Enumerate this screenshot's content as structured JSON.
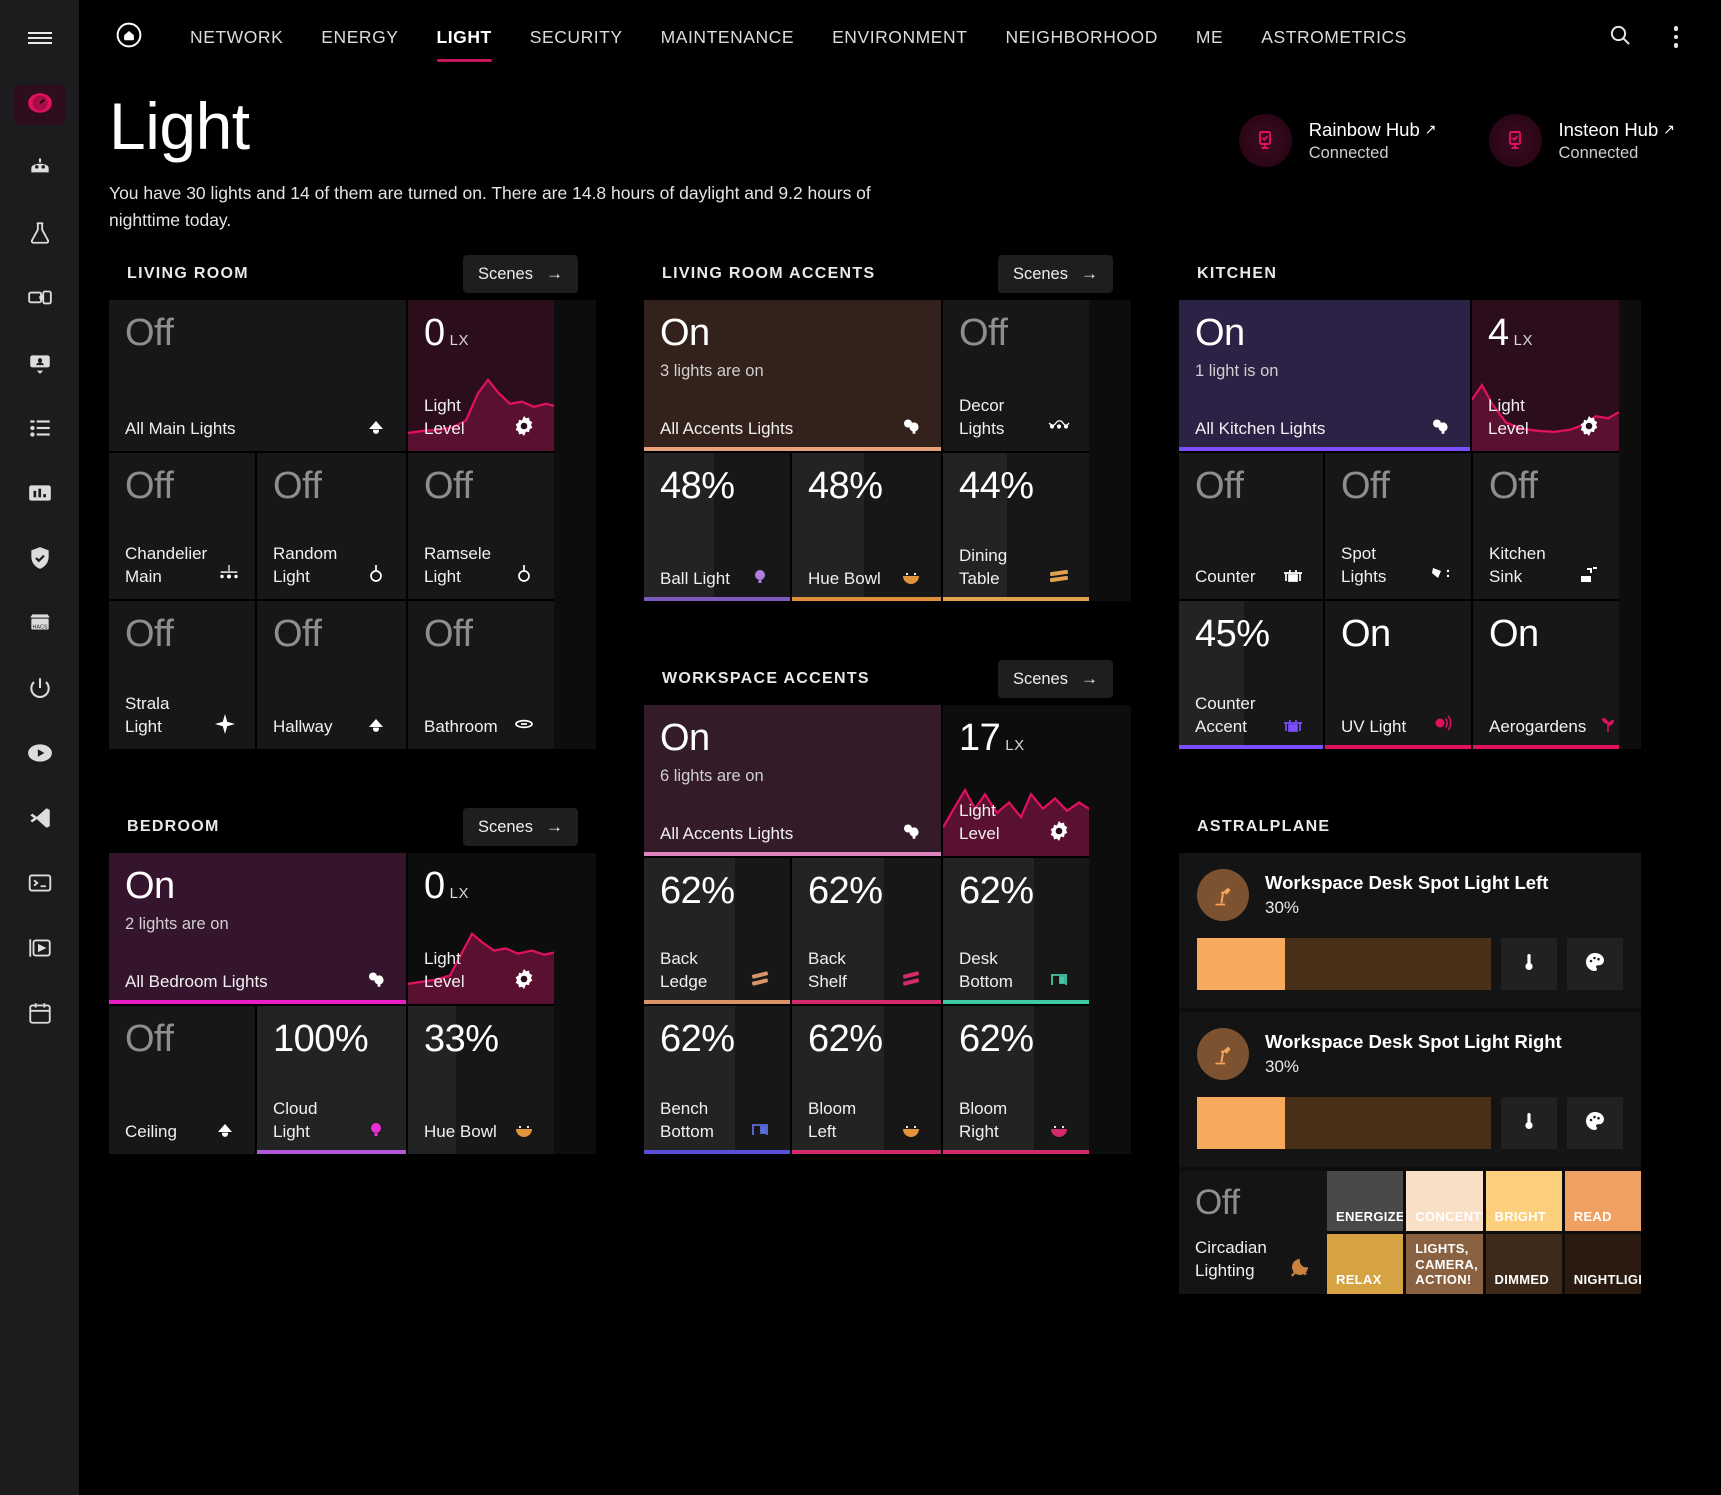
{
  "sidebar": {
    "menu_label": "menu",
    "items": [
      {
        "name": "dashboard",
        "icon": "gauge-icon",
        "active": true
      },
      {
        "name": "robot",
        "icon": "robot-icon",
        "active": false
      },
      {
        "name": "lab",
        "icon": "flask-icon",
        "active": false
      },
      {
        "name": "devices",
        "icon": "devices-icon",
        "active": false
      },
      {
        "name": "person",
        "icon": "person-card-icon",
        "active": false
      },
      {
        "name": "list",
        "icon": "list-icon",
        "active": false
      },
      {
        "name": "statistics",
        "icon": "bar-chart-icon",
        "active": false
      },
      {
        "name": "security",
        "icon": "shield-check-icon",
        "active": false
      },
      {
        "name": "hacs",
        "icon": "hacs-store-icon",
        "active": false,
        "label": "HACS"
      },
      {
        "name": "power",
        "icon": "power-icon",
        "active": false
      },
      {
        "name": "media",
        "icon": "play-circle-icon",
        "active": false
      },
      {
        "name": "vscode",
        "icon": "vscode-icon",
        "active": false
      },
      {
        "name": "terminal",
        "icon": "terminal-icon",
        "active": false
      },
      {
        "name": "video",
        "icon": "video-icon",
        "active": false
      },
      {
        "name": "calendar",
        "icon": "calendar-icon",
        "active": false
      }
    ]
  },
  "topnav": {
    "home_icon": "home-icon",
    "search_icon": "search-icon",
    "overflow_icon": "kebab-menu-icon",
    "tabs": [
      {
        "label": "NETWORK",
        "active": false
      },
      {
        "label": "ENERGY",
        "active": false
      },
      {
        "label": "LIGHT",
        "active": true
      },
      {
        "label": "SECURITY",
        "active": false
      },
      {
        "label": "MAINTENANCE",
        "active": false
      },
      {
        "label": "ENVIRONMENT",
        "active": false
      },
      {
        "label": "NEIGHBORHOOD",
        "active": false
      },
      {
        "label": "ME",
        "active": false
      },
      {
        "label": "ASTROMETRICS",
        "active": false
      }
    ]
  },
  "header": {
    "title": "Light",
    "subtitle": "You have 30 lights and 14 of them are turned on. There are 14.8 hours of daylight and 9.2 hours of nighttime today.",
    "hubs": [
      {
        "name": "Rainbow Hub",
        "link_arrow": "↗",
        "status": "Connected",
        "icon": "hub-device-icon"
      },
      {
        "name": "Insteon Hub",
        "link_arrow": "↗",
        "status": "Connected",
        "icon": "hub-device-icon"
      }
    ]
  },
  "scenes_button_label": "Scenes",
  "scenes_button_arrow": "→",
  "sections": {
    "living_room": {
      "title": "LIVING ROOM",
      "has_scenes": true,
      "main": {
        "state": "Off",
        "sub": "",
        "label": "All Main Lights",
        "icon": "ceiling-lamp-icon",
        "on": false,
        "accent": ""
      },
      "light_level": {
        "value": "0",
        "unit": "LX",
        "label": "Light Level",
        "icon": "gear-icon"
      },
      "tiles": [
        {
          "state": "Off",
          "label": "Chandelier Main",
          "icon": "chandelier-icon",
          "on": false,
          "fill": 0,
          "accent": ""
        },
        {
          "state": "Off",
          "label": "Random Light",
          "icon": "bulb-outline-icon",
          "on": false,
          "fill": 0,
          "accent": ""
        },
        {
          "state": "Off",
          "label": "Ramsele Light",
          "icon": "bulb-outline-icon",
          "on": false,
          "fill": 0,
          "accent": ""
        },
        {
          "state": "Off",
          "label": "Strala Light",
          "icon": "sparkle-icon",
          "on": false,
          "fill": 0,
          "accent": ""
        },
        {
          "state": "Off",
          "label": "Hallway",
          "icon": "ceiling-lamp-icon",
          "on": false,
          "fill": 0,
          "accent": ""
        },
        {
          "state": "Off",
          "label": "Bathroom",
          "icon": "vanity-light-icon",
          "on": false,
          "fill": 0,
          "accent": ""
        }
      ]
    },
    "living_room_accents": {
      "title": "LIVING ROOM ACCENTS",
      "has_scenes": true,
      "main": {
        "state": "On",
        "sub": "3 lights are on",
        "label": "All Accents Lights",
        "icon": "bulbs-icon",
        "on": true,
        "accent": "#e8a07a"
      },
      "side": {
        "state": "Off",
        "label": "Decor Lights",
        "icon": "string-lights-icon",
        "on": false,
        "accent": ""
      },
      "tiles": [
        {
          "state": "48%",
          "label": "Ball Light",
          "icon": "bulb-purple-icon",
          "on": true,
          "fill": 48,
          "accent": "#7d5bbe"
        },
        {
          "state": "48%",
          "label": "Hue Bowl",
          "icon": "bowl-orange-icon",
          "on": true,
          "fill": 48,
          "accent": "#e08d3c"
        },
        {
          "state": "44%",
          "label": "Dining Table",
          "icon": "led-strip-orange-icon",
          "on": true,
          "fill": 44,
          "accent": "#e0a050"
        }
      ]
    },
    "kitchen": {
      "title": "KITCHEN",
      "has_scenes": false,
      "main": {
        "state": "On",
        "sub": "1 light is on",
        "label": "All Kitchen Lights",
        "icon": "bulbs-icon",
        "on": true,
        "accent": "#7c4dff"
      },
      "light_level": {
        "value": "4",
        "unit": "LX",
        "label": "Light Level",
        "icon": "gear-icon"
      },
      "tiles": [
        {
          "state": "Off",
          "label": "Counter",
          "icon": "kitchen-counter-icon",
          "on": false,
          "fill": 0,
          "accent": ""
        },
        {
          "state": "Off",
          "label": "Spot Lights",
          "icon": "spotlight-icon",
          "on": false,
          "fill": 0,
          "accent": ""
        },
        {
          "state": "Off",
          "label": "Kitchen Sink",
          "icon": "faucet-icon",
          "on": false,
          "fill": 0,
          "accent": ""
        },
        {
          "state": "45%",
          "label": "Counter Accent",
          "icon": "kitchen-counter-purple-icon",
          "on": true,
          "fill": 45,
          "accent": "#7c4dff"
        },
        {
          "state": "On",
          "label": "UV Light",
          "icon": "uv-lamp-icon",
          "on": true,
          "fill": 0,
          "accent": "#e0115f"
        },
        {
          "state": "On",
          "label": "Aerogardens",
          "icon": "plant-icon",
          "on": true,
          "fill": 0,
          "accent": "#e0115f"
        }
      ]
    },
    "bedroom": {
      "title": "BEDROOM",
      "has_scenes": true,
      "main": {
        "state": "On",
        "sub": "2 lights are on",
        "label": "All Bedroom Lights",
        "icon": "bulbs-icon",
        "on": true,
        "accent": "#e91ec9"
      },
      "light_level": {
        "value": "0",
        "unit": "LX",
        "label": "Light Level",
        "icon": "gear-icon"
      },
      "tiles": [
        {
          "state": "Off",
          "label": "Ceiling",
          "icon": "ceiling-lamp-icon",
          "on": false,
          "fill": 0,
          "accent": ""
        },
        {
          "state": "100%",
          "label": "Cloud Light",
          "icon": "bulb-magenta-icon",
          "on": true,
          "fill": 100,
          "accent": "#b05ad8"
        },
        {
          "state": "33%",
          "label": "Hue Bowl",
          "icon": "bowl-orange-icon",
          "on": true,
          "fill": 33,
          "accent": ""
        }
      ]
    },
    "workspace_accents": {
      "title": "WORKSPACE ACCENTS",
      "has_scenes": true,
      "main": {
        "state": "On",
        "sub": "6 lights are on",
        "label": "All Accents Lights",
        "icon": "bulbs-icon",
        "on": true,
        "accent": "#dd85c0"
      },
      "light_level": {
        "value": "17",
        "unit": "LX",
        "label": "Light Level",
        "icon": "gear-icon"
      },
      "tiles": [
        {
          "state": "62%",
          "label": "Back Ledge",
          "icon": "led-strip-orange-icon",
          "on": true,
          "fill": 62,
          "accent": "#d99368"
        },
        {
          "state": "62%",
          "label": "Back Shelf",
          "icon": "led-strip-pink-icon",
          "on": true,
          "fill": 62,
          "accent": "#d32a6b"
        },
        {
          "state": "62%",
          "label": "Desk Bottom",
          "icon": "desk-teal-icon",
          "on": true,
          "fill": 62,
          "accent": "#3fc9a5"
        },
        {
          "state": "62%",
          "label": "Bench Bottom",
          "icon": "desk-blue-icon",
          "on": true,
          "fill": 62,
          "accent": "#5b4ddb"
        },
        {
          "state": "62%",
          "label": "Bloom Left",
          "icon": "bowl-orange-icon",
          "on": true,
          "fill": 62,
          "accent": "#d32a6b"
        },
        {
          "state": "62%",
          "label": "Bloom Right",
          "icon": "bowl-pink-icon",
          "on": true,
          "fill": 62,
          "accent": "#d32a6b"
        }
      ]
    },
    "astralplane": {
      "title": "ASTRALPLANE",
      "has_scenes": false,
      "lights": [
        {
          "name": "Workspace Desk Spot Light Left",
          "pct": "30%",
          "fill": 30,
          "icon": "desk-lamp-icon",
          "temp_icon": "thermometer-icon",
          "color_icon": "palette-icon"
        },
        {
          "name": "Workspace Desk Spot Light Right",
          "pct": "30%",
          "fill": 30,
          "icon": "desk-lamp-icon",
          "temp_icon": "thermometer-icon",
          "color_icon": "palette-icon"
        }
      ],
      "circadian": {
        "state": "Off",
        "label": "Circadian Lighting",
        "icon": "moon-sparkle-icon",
        "scenes": [
          {
            "label": "ENERGIZE",
            "bg": "#494949",
            "fg": "#ffffff"
          },
          {
            "label": "CONCENTRATE",
            "bg": "#fadfc7",
            "fg": "#ffffff"
          },
          {
            "label": "BRIGHT",
            "bg": "#fbcf7c",
            "fg": "#ffffff"
          },
          {
            "label": "READ",
            "bg": "#f0a061",
            "fg": "#ffffff"
          },
          {
            "label": "RELAX",
            "bg": "#d6a343",
            "fg": "#ffffff"
          },
          {
            "label": "LIGHTS, CAMERA, ACTION!",
            "bg": "#8a6242",
            "fg": "#ffffff"
          },
          {
            "label": "DIMMED",
            "bg": "#3d2a1b",
            "fg": "#ffffff"
          },
          {
            "label": "NIGHTLIGHT",
            "bg": "#2a1a10",
            "fg": "#ffffff"
          }
        ]
      }
    }
  }
}
